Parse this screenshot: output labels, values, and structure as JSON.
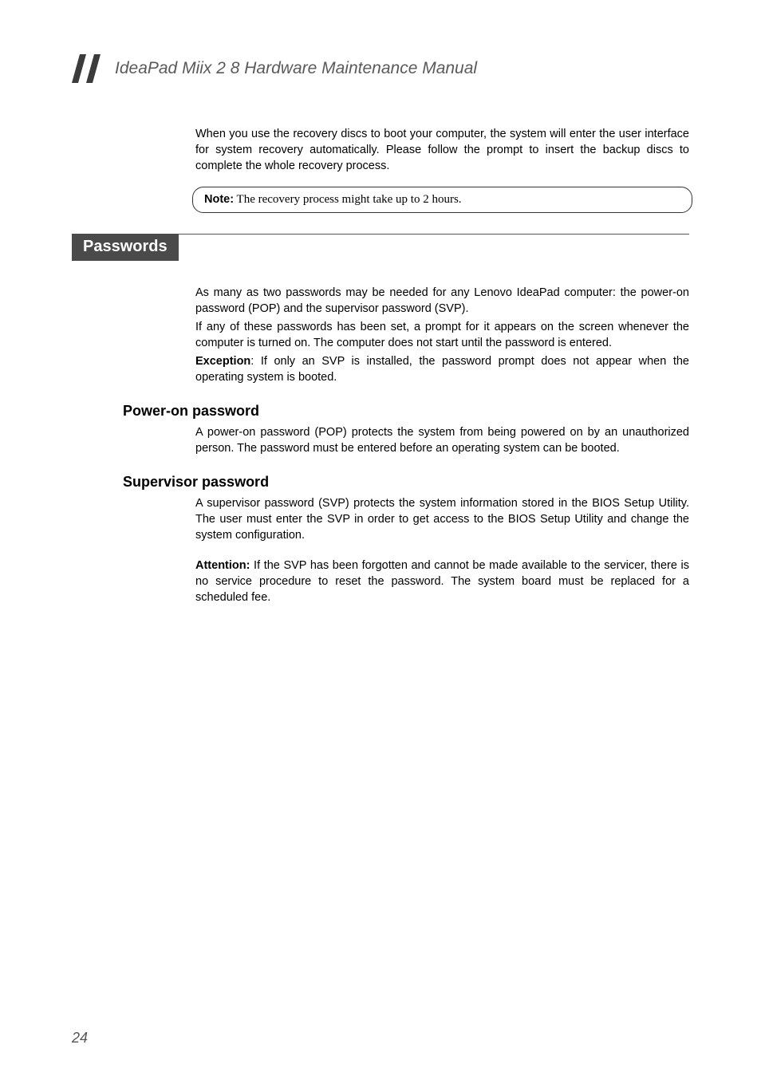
{
  "header": {
    "title": "IdeaPad Miix 2 8 Hardware Maintenance Manual"
  },
  "intro": {
    "p1": "When you use the recovery discs to boot your computer, the system will enter the user interface for system recovery automatically. Please follow the prompt to insert the backup discs to complete the whole recovery process."
  },
  "note": {
    "label": "Note:",
    "text": " The recovery process might take up to 2 hours."
  },
  "section": {
    "title": "Passwords",
    "p1": "As many as two passwords may be needed for any Lenovo IdeaPad computer: the power-on password (POP) and the supervisor password (SVP).",
    "p2": "If any of these passwords has been set, a prompt for it appears on the screen whenever the computer is turned on. The computer does not start until the password is entered.",
    "exception_label": "Exception",
    "exception_text": ": If only an SVP is installed, the password prompt does not appear when the operating system is booted."
  },
  "sub1": {
    "heading": "Power-on password",
    "p1": "A power-on password (POP) protects the system from being powered on by an unauthorized person. The password must be entered before an operating system can be booted."
  },
  "sub2": {
    "heading": "Supervisor password",
    "p1": "A supervisor password (SVP) protects the system information stored in the BIOS Setup Utility. The user must enter the SVP in order to get access to the BIOS Setup Utility and change the system configuration.",
    "attention_label": "Attention:",
    "attention_text": " If the SVP has been forgotten and cannot be made available to the servicer, there is no service procedure to reset the password. The system board must be replaced for a scheduled fee."
  },
  "page_number": "24"
}
